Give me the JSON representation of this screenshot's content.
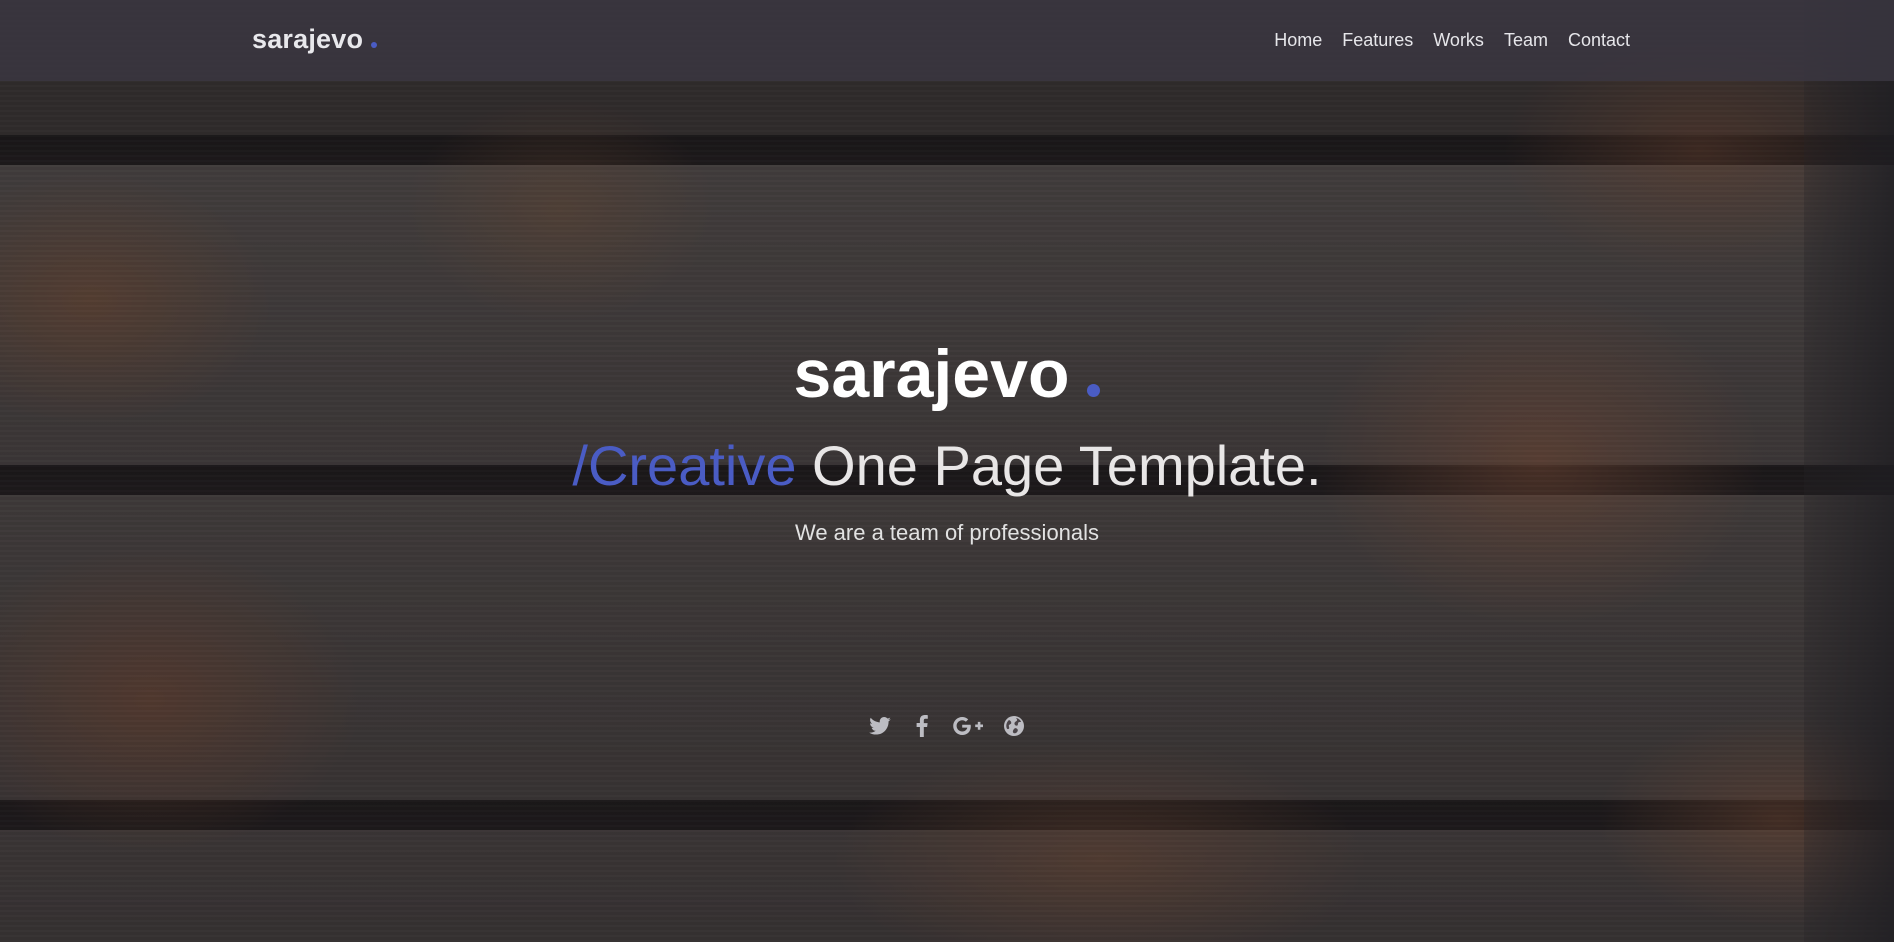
{
  "header": {
    "brand": "sarajevo",
    "nav": [
      "Home",
      "Features",
      "Works",
      "Team",
      "Contact"
    ]
  },
  "hero": {
    "title": "sarajevo",
    "tagline_accent": "/Creative",
    "tagline_rest": " One Page Template.",
    "subtitle": "We are a team of professionals"
  },
  "social": [
    "twitter-icon",
    "facebook-icon",
    "google-plus-icon",
    "globe-icon"
  ],
  "colors": {
    "accent": "#4a5cc4",
    "text": "#ffffff"
  }
}
